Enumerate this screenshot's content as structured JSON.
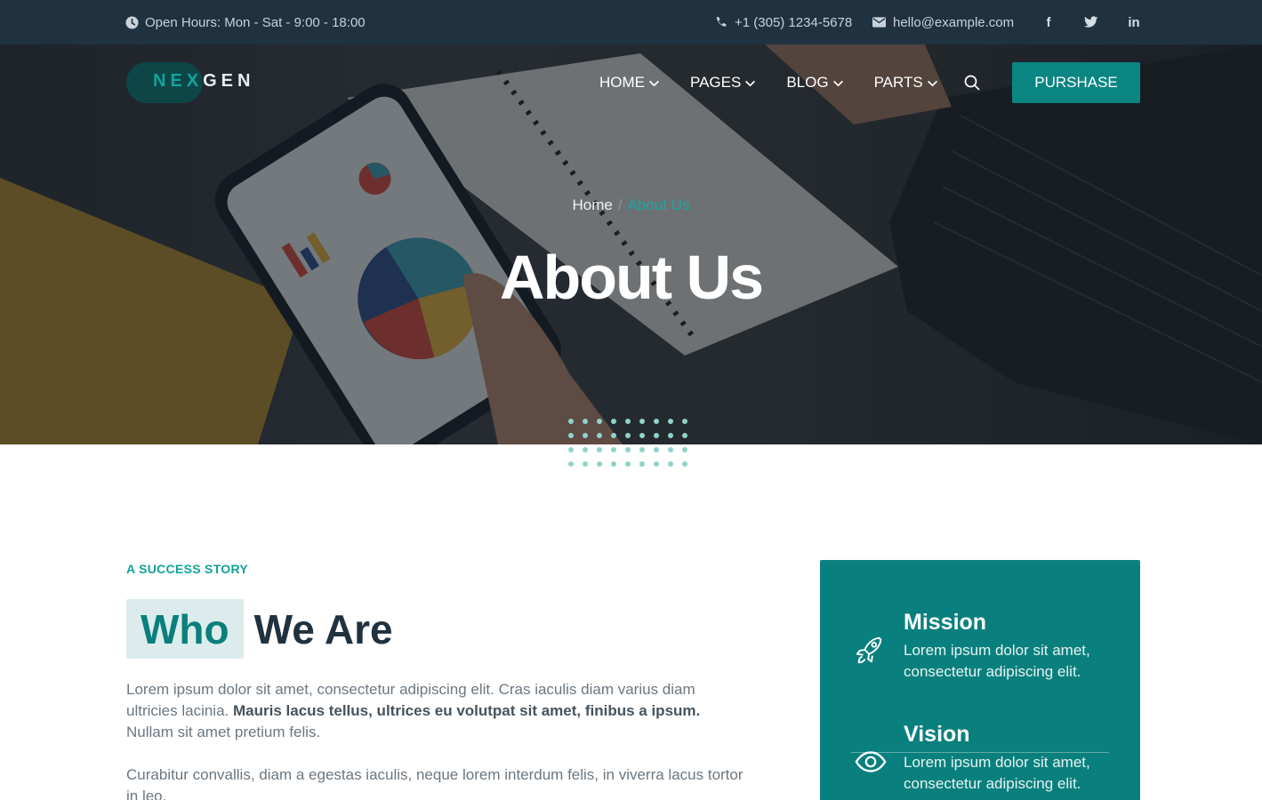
{
  "topbar": {
    "hours": "Open Hours: Mon - Sat - 9:00 - 18:00",
    "phone": "+1 (305) 1234-5678",
    "email": "hello@example.com",
    "socials": [
      "f",
      "t",
      "in"
    ]
  },
  "brand": {
    "part1": "NEX",
    "part2": "GEN"
  },
  "nav": {
    "items": [
      "HOME",
      "PAGES",
      "BLOG",
      "PARTS"
    ],
    "cta": "PURSHASE"
  },
  "hero": {
    "breadcrumb": {
      "home": "Home",
      "separator": "/",
      "current": "About Us"
    },
    "title": "About Us"
  },
  "about": {
    "kicker": "A SUCCESS STORY",
    "heading_highlight": "Who",
    "heading_rest": "We Are",
    "para1_a": "Lorem ipsum dolor sit amet, consectetur adipiscing elit. Cras iaculis diam varius diam ultricies lacinia. ",
    "para1_b": "Mauris lacus tellus, ultrices eu volutpat sit amet, finibus a ipsum.",
    "para1_c": " Nullam sit amet pretium felis.",
    "para2": "Curabitur convallis, diam a egestas iaculis, neque lorem interdum felis, in viverra lacus tortor in leo."
  },
  "card": {
    "mission_title": "Mission",
    "mission_text": "Lorem ipsum dolor sit amet, consectetur adipiscing elit.",
    "vision_title": "Vision",
    "vision_text": "Lorem ipsum dolor sit amet, consectetur adipiscing elit."
  },
  "colors": {
    "accent": "#0a8582",
    "topbar": "#203240",
    "heading": "#203240"
  }
}
